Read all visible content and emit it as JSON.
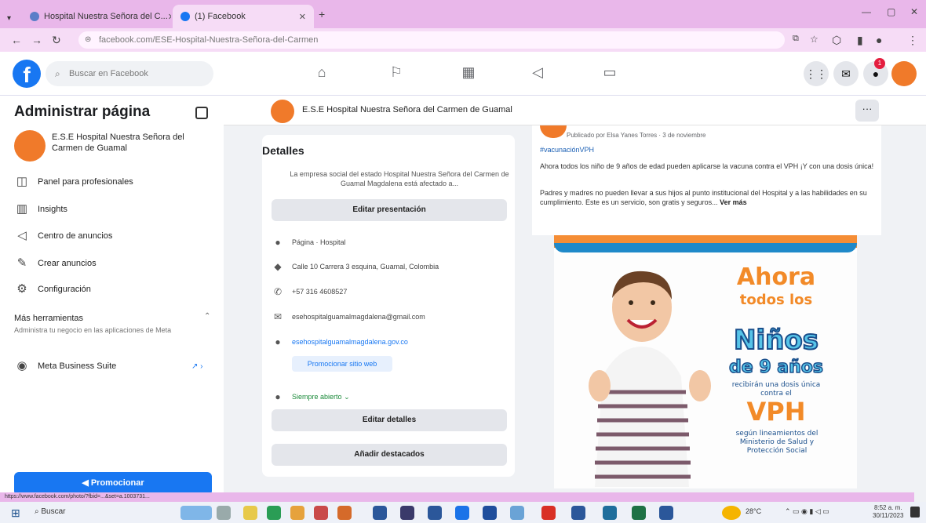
{
  "browser": {
    "tabs": [
      {
        "label": "Hospital Nuestra Señora del C..."
      },
      {
        "label": "(1) Facebook"
      }
    ],
    "new_tab": "+",
    "url": "facebook.com/ESE-Hospital-Nuestra-Señora-del-Carmen"
  },
  "fbnav": {
    "logo": "f",
    "search_placeholder": "Buscar en Facebook",
    "notification_count": "1"
  },
  "sidebar": {
    "title": "Administrar página",
    "page_name": "E.S.E Hospital Nuestra Señora del Carmen de Guamal",
    "items": [
      {
        "label": "Panel para profesionales",
        "icon": "dashboard-icon"
      },
      {
        "label": "Insights",
        "icon": "insights-icon"
      },
      {
        "label": "Centro de anuncios",
        "icon": "megaphone-icon"
      },
      {
        "label": "Crear anuncios",
        "icon": "edit-icon"
      },
      {
        "label": "Configuración",
        "icon": "gear-icon"
      }
    ],
    "tools_title": "Más herramientas",
    "tools_desc": "Administra tu negocio en las aplicaciones de Meta",
    "meta_suite": "Meta Business Suite",
    "promote_label": "Promocionar"
  },
  "pagebar": {
    "name": "E.S.E Hospital Nuestra Señora del Carmen de Guamal",
    "more": "···"
  },
  "details": {
    "title": "Detalles",
    "description": "La empresa social del estado Hospital Nuestra Señora del Carmen de Guamal Magdalena está afectado a...",
    "edit_presentation": "Editar presentación",
    "rows": [
      {
        "icon": "info-icon",
        "text": "Página · Hospital"
      },
      {
        "icon": "location-icon",
        "text": "Calle 10 Carrera 3 esquina, Guamal, Colombia"
      },
      {
        "icon": "phone-icon",
        "text": "+57 316 4608527"
      },
      {
        "icon": "mail-icon",
        "text": "esehospitalguamalmagdalena@gmail.com"
      },
      {
        "icon": "globe-icon",
        "text": "esehospitalguamalmagdalena.gov.co"
      }
    ],
    "promote_web": "Promocionar sitio web",
    "open_status": "Siempre abierto",
    "edit_details": "Editar detalles",
    "add_featured": "Añadir destacados"
  },
  "post": {
    "meta": "Publicado por Elsa Yanes Torres · 3 de noviembre",
    "hashtag": "#vacunaciónVPH",
    "text1": "Ahora todos los niño de 9 años de edad pueden aplicarse la vacuna contra el VPH ¡Y con una dosis única!",
    "text2": "Padres y madres no pueden llevar a sus hijos al punto institucional del Hospital y a las habilidades en su cumplimiento. Este es un servicio, son gratis y seguros...",
    "see_more": "Ver más",
    "image_text": {
      "ahora": "Ahora",
      "todos": "todos los",
      "ninos": "Niños",
      "de9": "de 9 años",
      "reciben": "recibirán una dosis única contra el",
      "vph": "VPH",
      "segun": "según lineamientos del Ministerio de Salud y Protección Social"
    }
  },
  "status_url": "https://www.facebook.com/photo/?fbid=...&set=a.1003731...",
  "taskbar": {
    "search": "Buscar",
    "tray": "28°C",
    "time": "8:52 a. m.",
    "date": "30/11/2023"
  }
}
